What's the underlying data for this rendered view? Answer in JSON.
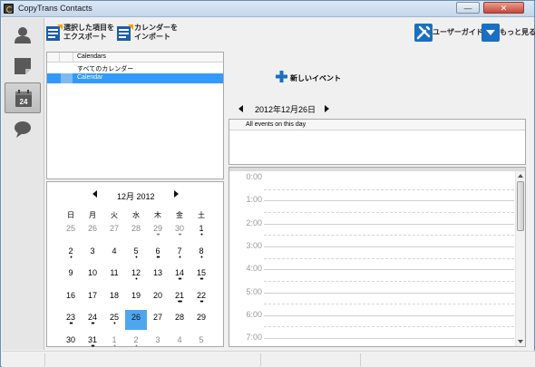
{
  "window": {
    "title": "CopyTrans Contacts",
    "minimize_label": "—",
    "close_label": "✕"
  },
  "sidebar": {
    "items": [
      {
        "name": "contacts",
        "icon": "person-icon"
      },
      {
        "name": "notes",
        "icon": "note-icon"
      },
      {
        "name": "calendar",
        "icon": "calendar-icon",
        "badge": "24",
        "active": true
      },
      {
        "name": "messages",
        "icon": "speech-bubble-icon"
      }
    ]
  },
  "toolbar": {
    "export_label": "選択した項目を\nエクスポート",
    "import_label": "カレンダーを\nインポート",
    "user_guide_label": "ユーザーガイド",
    "more_label": "もっと見る"
  },
  "calendar_list": {
    "header": "Calendars",
    "rows": [
      {
        "label": "すべてのカレンダー",
        "selected": false
      },
      {
        "label": "Calendar",
        "selected": true
      }
    ]
  },
  "mini_calendar": {
    "title": "12月 2012",
    "weekdays": [
      "日",
      "月",
      "火",
      "水",
      "木",
      "金",
      "土"
    ],
    "weeks": [
      [
        {
          "d": "25",
          "o": true,
          "dots": ""
        },
        {
          "d": "26",
          "o": true,
          "dots": ""
        },
        {
          "d": "27",
          "o": true,
          "dots": ""
        },
        {
          "d": "28",
          "o": true,
          "dots": ""
        },
        {
          "d": "29",
          "o": true,
          "dots": "••"
        },
        {
          "d": "30",
          "o": true,
          "dots": "••"
        },
        {
          "d": "1",
          "o": false,
          "dots": "•"
        }
      ],
      [
        {
          "d": "2",
          "o": false,
          "dots": "•"
        },
        {
          "d": "3",
          "o": false,
          "dots": ""
        },
        {
          "d": "4",
          "o": false,
          "dots": ""
        },
        {
          "d": "5",
          "o": false,
          "dots": "•"
        },
        {
          "d": "6",
          "o": false,
          "dots": "••"
        },
        {
          "d": "7",
          "o": false,
          "dots": "•"
        },
        {
          "d": "8",
          "o": false,
          "dots": "•"
        }
      ],
      [
        {
          "d": "9",
          "o": false,
          "dots": ""
        },
        {
          "d": "10",
          "o": false,
          "dots": ""
        },
        {
          "d": "11",
          "o": false,
          "dots": ""
        },
        {
          "d": "12",
          "o": false,
          "dots": "•"
        },
        {
          "d": "13",
          "o": false,
          "dots": ""
        },
        {
          "d": "14",
          "o": false,
          "dots": "••"
        },
        {
          "d": "15",
          "o": false,
          "dots": "••"
        }
      ],
      [
        {
          "d": "16",
          "o": false,
          "dots": ""
        },
        {
          "d": "17",
          "o": false,
          "dots": ""
        },
        {
          "d": "18",
          "o": false,
          "dots": ""
        },
        {
          "d": "19",
          "o": false,
          "dots": ""
        },
        {
          "d": "20",
          "o": false,
          "dots": ""
        },
        {
          "d": "21",
          "o": false,
          "dots": "•••"
        },
        {
          "d": "22",
          "o": false,
          "dots": "••"
        }
      ],
      [
        {
          "d": "23",
          "o": false,
          "dots": "••"
        },
        {
          "d": "24",
          "o": false,
          "dots": "••"
        },
        {
          "d": "25",
          "o": false,
          "dots": "•"
        },
        {
          "d": "26",
          "o": false,
          "dots": "",
          "today": true
        },
        {
          "d": "27",
          "o": false,
          "dots": ""
        },
        {
          "d": "28",
          "o": false,
          "dots": ""
        },
        {
          "d": "29",
          "o": false,
          "dots": ""
        }
      ],
      [
        {
          "d": "30",
          "o": false,
          "dots": ""
        },
        {
          "d": "31",
          "o": false,
          "dots": "••"
        },
        {
          "d": "1",
          "o": true,
          "dots": "•"
        },
        {
          "d": "2",
          "o": true,
          "dots": "•"
        },
        {
          "d": "3",
          "o": true,
          "dots": ""
        },
        {
          "d": "4",
          "o": true,
          "dots": ""
        },
        {
          "d": "5",
          "o": true,
          "dots": ""
        }
      ]
    ]
  },
  "day_view": {
    "new_event_label": "新しいイベント",
    "date_title": "2012年12月26日",
    "all_day_header": "All events on this day",
    "hours": [
      "0:00",
      "1:00",
      "2:00",
      "3:00",
      "4:00",
      "5:00",
      "6:00",
      "7:00"
    ]
  }
}
